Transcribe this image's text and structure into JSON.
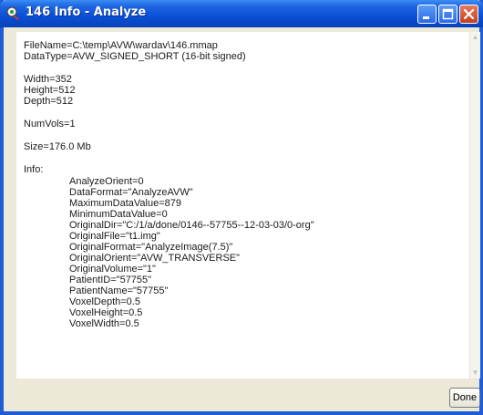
{
  "window": {
    "title": "146 Info - Analyze",
    "accent_color": "#0a4fd6",
    "close_color": "#c3401c"
  },
  "icons": {
    "app": "analyze-app-icon",
    "minimize": "minimize-icon",
    "maximize": "maximize-icon",
    "close": "close-icon"
  },
  "header": [
    "FileName=C:\\temp\\AVW\\wardav\\146.mmap",
    "DataType=AVW_SIGNED_SHORT (16-bit signed)"
  ],
  "dims": [
    "Width=352",
    "Height=512",
    "Depth=512"
  ],
  "numvols": "NumVols=1",
  "size": "Size=176.0 Mb",
  "info_label": "Info:",
  "info": [
    "AnalyzeOrient=0",
    "DataFormat=\"AnalyzeAVW\"",
    "MaximumDataValue=879",
    "MinimumDataValue=0",
    "OriginalDir=\"C:/1/a/done/0146--57755--12-03-03/0-org\"",
    "OriginalFile=\"t1.img\"",
    "OriginalFormat=\"AnalyzeImage(7.5)\"",
    "OriginalOrient=\"AVW_TRANSVERSE\"",
    "OriginalVolume=\"1\"",
    "PatientID=\"57755\"",
    "PatientName=\"57755\"",
    "VoxelDepth=0.5",
    "VoxelHeight=0.5",
    "VoxelWidth=0.5"
  ],
  "footer": {
    "done_label": "Done"
  }
}
